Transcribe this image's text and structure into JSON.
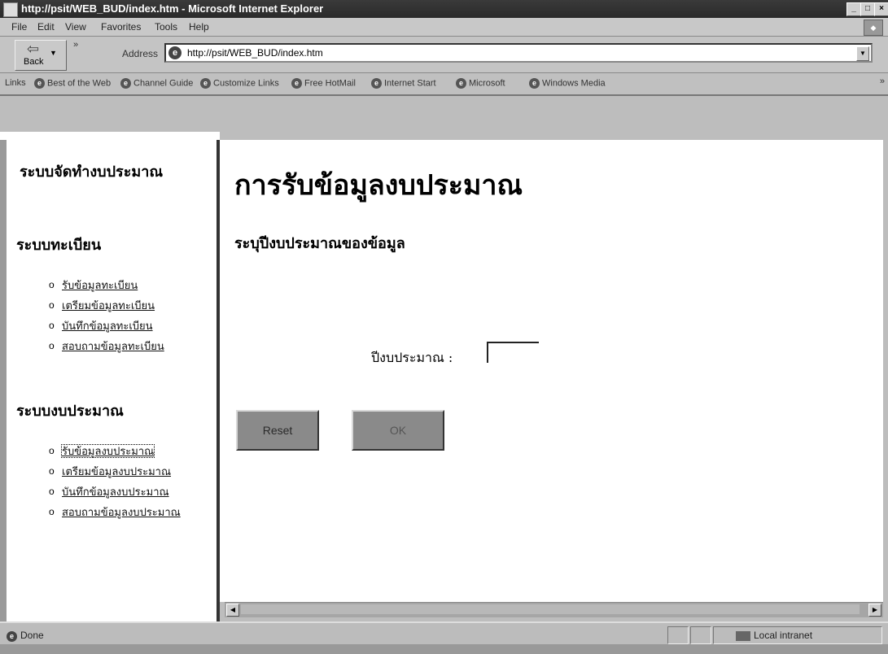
{
  "window": {
    "title": "http://psit/WEB_BUD/index.htm - Microsoft Internet Explorer",
    "buttons": [
      "_",
      "□",
      "×"
    ]
  },
  "menu": {
    "items": [
      "File",
      "Edit",
      "View",
      "Favorites",
      "Tools",
      "Help"
    ]
  },
  "toolbar": {
    "back_label": "Back",
    "address_label": "Address",
    "url": "http://psit/WEB_BUD/index.htm"
  },
  "links_bar": {
    "label": "Links",
    "items": [
      "Best of the Web",
      "Channel Guide",
      "Customize Links",
      "Free HotMail",
      "Internet Start",
      "Microsoft",
      "Windows Media"
    ]
  },
  "sidebar": {
    "title": "ระบบจัดทำงบประมาณ",
    "registration": {
      "heading": "ระบบทะเบียน",
      "items": [
        "รับข้อมูลทะเบียน",
        "เตรียมข้อมูลทะเบียน",
        "บันทึกข้อมูลทะเบียน",
        "สอบถามข้อมูลทะเบียน"
      ]
    },
    "budget": {
      "heading": "ระบบงบประมาณ",
      "items": [
        "รับข้อมูลงบประมาณ",
        "เตรียมข้อมูลงบประมาณ",
        "บันทึกข้อมูลงบประมาณ",
        "สอบถามข้อมูลงบประมาณ"
      ]
    }
  },
  "main": {
    "title": "การรับข้อมูลงบประมาณ",
    "subtitle": "ระบุปีงบประมาณของข้อมูล",
    "year_label": "ปีงบประมาณ :",
    "year_value": "",
    "reset_label": "Reset",
    "ok_label": "OK"
  },
  "status": {
    "text": "Done",
    "zone": "Local intranet"
  }
}
